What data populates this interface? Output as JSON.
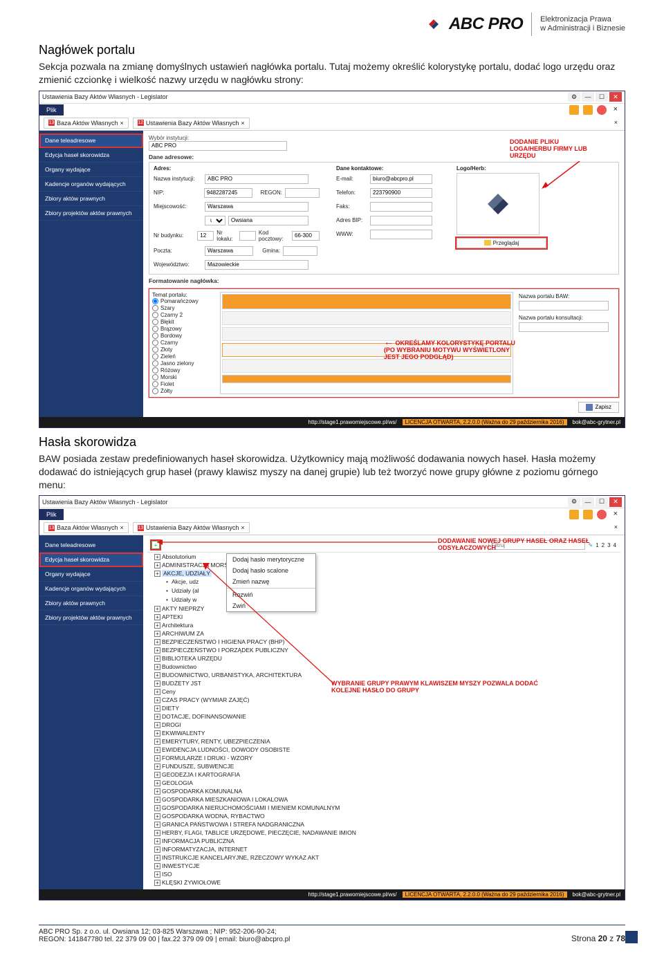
{
  "logo": {
    "brand": "ABC PRO",
    "sub1": "Elektronizacja Prawa",
    "sub2": "w Administracji i Biznesie"
  },
  "sec1": {
    "title": "Nagłówek portalu",
    "p": "Sekcja pozwala na zmianę domyślnych ustawień nagłówka portalu. Tutaj możemy określić kolorystykę portalu, dodać logo urzędu oraz zmienić czcionkę i wielkość nazwy urzędu w nagłówku strony:"
  },
  "sec2": {
    "title": "Hasła skorowidza",
    "p": "BAW posiada zestaw predefiniowanych haseł skorowidza. Użytkownicy mają możliwość dodawania nowych haseł. Hasła możemy dodawać do istniejących grup haseł (prawy klawisz myszy na danej grupie) lub też tworzyć nowe grupy główne z poziomu górnego menu:"
  },
  "app": {
    "title": "Ustawienia Bazy Aktów Własnych - Legislator",
    "menu": "Plik",
    "tab1": "Baza Aktów Własnych",
    "tab2": "Ustawienia Bazy Aktów Własnych",
    "tab_badge1": "13",
    "tab_badge2": "12",
    "tab_badge3": "13",
    "close_x": "×"
  },
  "sidebar": {
    "items": [
      "Dane teleadresowe",
      "Edycja haseł skorowidza",
      "Organy wydające",
      "Kadencje organów wydających",
      "Zbiory aktów prawnych",
      "Zbiory projektów aktów prawnych"
    ]
  },
  "form": {
    "wybor": "Wybór instytucji:",
    "abc": "ABC PRO",
    "dane": "Dane adresowe:",
    "adres_lbl": "Adres:",
    "dane_kont": "Dane kontaktowe:",
    "logo_lbl": "Logo/Herb:",
    "nazwa": "Nazwa instytucji:",
    "nazwa_v": "ABC PRO",
    "nip": "NIP:",
    "nip_v": "9482287245",
    "regon": "REGON:",
    "miejsc": "Miejscowość:",
    "miejsc_v": "Warszawa",
    "ul": "ul",
    "ul_v": "Owsiana",
    "nrbud": "Nr budynku:",
    "nrbud_v": "12",
    "nrlok": "Nr lokalu:",
    "kod": "Kod pocztowy:",
    "kod_v": "66-300",
    "poczta": "Poczta:",
    "poczta_v": "Warszawa",
    "gmina": "Gmina:",
    "woj": "Województwo:",
    "woj_v": "Mazowieckie",
    "email": "E-mail:",
    "email_v": "biuro@abcpro.pl",
    "tel": "Telefon:",
    "tel_v": "223790900",
    "faks": "Faks:",
    "bip": "Adres BIP:",
    "www": "WWW:",
    "przegladaj": "Przeglądaj",
    "format": "Formatowanie nagłówka:",
    "temat": "Temat portalu:",
    "nazwa_baw": "Nazwa portalu BAW:",
    "nazwa_kons": "Nazwa portalu konsultacji:",
    "zapisz": "Zapisz"
  },
  "colors": [
    "Pomarańczowy",
    "Szary",
    "Czarny 2",
    "Błękit",
    "Brązowy",
    "Bordowy",
    "Czarny",
    "Złoty",
    "Zieleń",
    "Jasno zielony",
    "Różowy",
    "Morski",
    "Fiolet",
    "Żółty"
  ],
  "annot": {
    "a1": "DODANIE PLIKU LOGA/HERBU FIRMY LUB URZĘDU",
    "a2": "OKREŚLAMY KOLORYSTYKĘ PORTALU (PO WYBRANIU MOTYWU WYŚWIETLONY JEST JEGO PODGLĄD)",
    "a3": "DODAWANIE NOWEJ GRUPY HASEŁ ORAZ HASEŁ ODSYŁACZOWYCH",
    "a4": "WYBRANIE GRUPY PRAWYM KLAWISZEM MYSZY POZWALA DODAĆ KOLEJNE HASŁO DO GRUPY"
  },
  "status": {
    "url": "http://stage1.prawomiejscowe.pl/ws/",
    "lic": "LICENCJA OTWARTA, 2.2.0.0 (Ważna do 29 października 2016)",
    "bok": "bok@abc-grytner.pl"
  },
  "filtr": {
    "label": "Filtruj",
    "p1": "1",
    "p2": "2",
    "p3": "3",
    "p4": "4",
    "plus": "+",
    "pencil": "✎"
  },
  "ctx": {
    "i1": "Dodaj hasło merytoryczne",
    "i2": "Dodaj hasło scalone",
    "i3": "Zmień nazwę",
    "i4": "Rozwiń",
    "i5": "Zwiń"
  },
  "tree": {
    "sel": "AKCJE, UDZIAŁY",
    "items": [
      "Absolutorium",
      "ADMINISTRACJA MORSKA",
      "AKCJE, UDZIAŁY",
      "Akcje, udz",
      "Udziały (al",
      "Udziały w",
      "AKTY NIEPRZY",
      "APTEKI",
      "Architektura",
      "ARCHIWUM ZA",
      "BEZPIECZEŃSTWO I HIGIENA PRACY (BHP)",
      "BEZPIECZEŃSTWO I PORZĄDEK PUBLICZNY",
      "BIBLIOTEKA URZĘDU",
      "Budownictwo",
      "BUDOWNICTWO, URBANISTYKA, ARCHITEKTURA",
      "BUDŻETY JST",
      "Ceny",
      "CZAS PRACY (WYMIAR ZAJĘĆ)",
      "DIETY",
      "DOTACJE, DOFINANSOWANIE",
      "DROGI",
      "EKWIWALENTY",
      "EMERYTURY, RENTY, UBEZPIECZENIA",
      "EWIDENCJA LUDNOŚCI, DOWODY OSOBISTE",
      "FORMULARZE I DRUKI - WZORY",
      "FUNDUSZE, SUBWENCJE",
      "GEODEZJA I KARTOGRAFIA",
      "GEOLOGIA",
      "GOSPODARKA KOMUNALNA",
      "GOSPODARKA MIESZKANIOWA I LOKALOWA",
      "GOSPODARKA NIERUCHOMOŚCIAMI I MIENIEM KOMUNALNYM",
      "GOSPODARKA WODNA, RYBACTWO",
      "GRANICA PAŃSTWOWA I STREFA NADGRANICZNA",
      "HERBY, FLAGI, TABLICE URZĘDOWE, PIECZĘCIE, NADAWANIE IMION",
      "INFORMACJA PUBLICZNA",
      "INFORMATYZACJA, INTERNET",
      "INSTRUKCJE KANCELARYJNE, RZECZOWY WYKAZ AKT",
      "INWESTYCJE",
      "ISO",
      "KLĘSKI ŻYWIOŁOWE"
    ]
  },
  "footer": {
    "l1": "ABC PRO Sp. z o.o. ul. Owsiana 12;  03-825 Warszawa ; NIP: 952-206-90-24;",
    "l2": "REGON: 141847780 tel. 22 379 09 00 | fax.22 379 09 09 | email: biuro@abcpro.pl",
    "page_a": "Strona ",
    "page_n": "20",
    "page_b": " z ",
    "page_t": "78"
  }
}
